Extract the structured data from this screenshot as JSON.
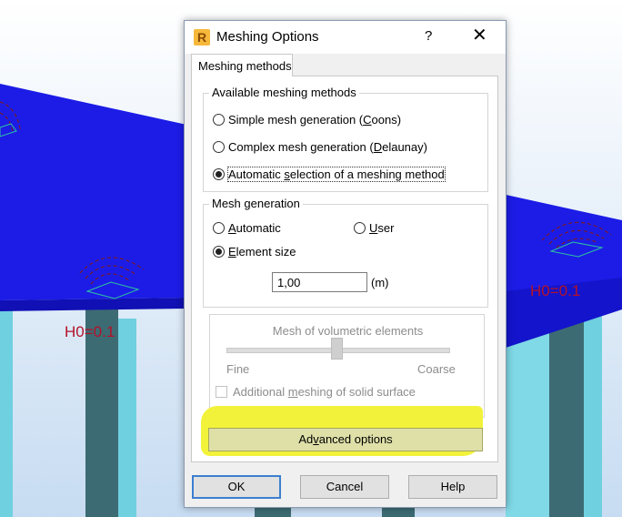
{
  "viewport": {
    "labels": [
      "H0=0.1",
      "H0=0.1"
    ]
  },
  "dialog": {
    "title": "Meshing Options",
    "help_glyph": "?",
    "close_glyph": "✕",
    "app_icon_letter": "R",
    "tab_label": "Meshing methods",
    "available_methods": {
      "legend": "Available meshing methods",
      "options": [
        {
          "pre": "Simple mesh generation (",
          "key": "C",
          "post": "oons)",
          "checked": false
        },
        {
          "pre": "Complex mesh generation (",
          "key": "D",
          "post": "elaunay)",
          "checked": false
        },
        {
          "pre": "Automatic ",
          "key": "s",
          "post": "election of a meshing method",
          "checked": true
        }
      ]
    },
    "mesh_generation": {
      "legend": "Mesh generation",
      "automatic": {
        "key": "A",
        "rest": "utomatic",
        "checked": false
      },
      "user": {
        "key": "U",
        "rest": "ser",
        "checked": false
      },
      "element_size": {
        "key": "E",
        "rest": "lement size",
        "checked": true
      },
      "size_value": "1,00",
      "unit": "(m)"
    },
    "volumetric": {
      "title": "Mesh of volumetric elements",
      "fine_label": "Fine",
      "coarse_label": "Coarse",
      "slider_position": 0.5,
      "solid_surface": {
        "pre": "Additional ",
        "key": "m",
        "post": "eshing of solid surface",
        "checked": false
      }
    },
    "advanced_button": {
      "pre": "Ad",
      "key": "v",
      "post": "anced options"
    },
    "buttons": {
      "ok": "OK",
      "cancel": "Cancel",
      "help": "Help"
    },
    "highlight_color": "#f2f23a"
  }
}
